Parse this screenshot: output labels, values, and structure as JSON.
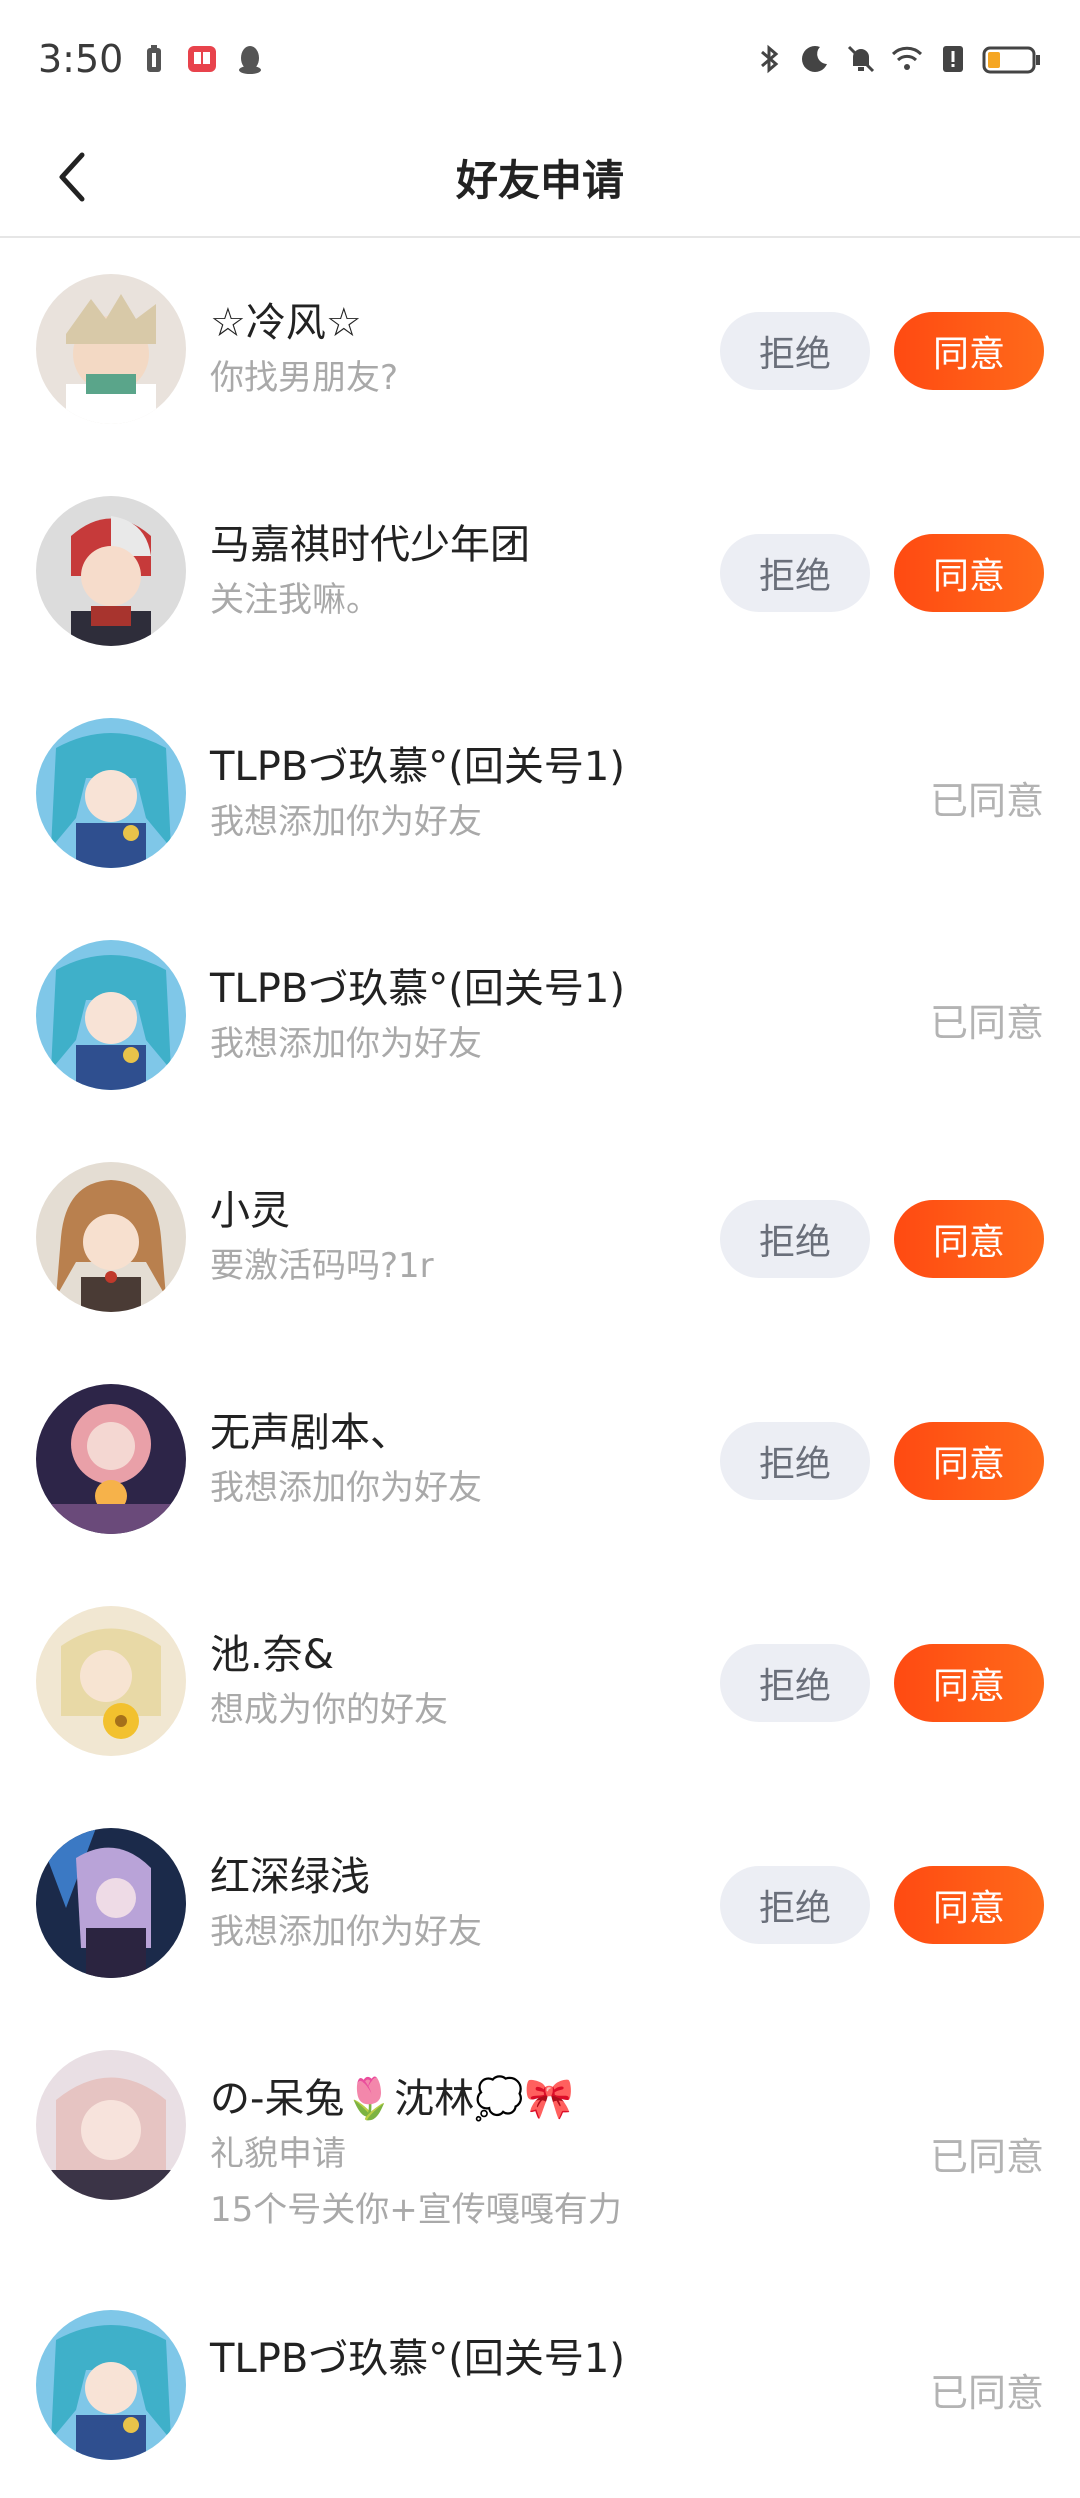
{
  "status_bar": {
    "time": "3:50",
    "left_icons": [
      "battery-saver-icon",
      "book-app-icon",
      "qq-penguin-icon"
    ],
    "right_icons": [
      "bluetooth-icon",
      "moon-icon",
      "mute-bell-icon",
      "wifi-icon",
      "sim-alert-icon",
      "battery-low-icon"
    ]
  },
  "header": {
    "title": "好友申请"
  },
  "colors": {
    "accent": "#ff5a14",
    "reject_bg": "#eceef4",
    "muted_text": "#a9a9a9"
  },
  "labels": {
    "reject": "拒绝",
    "accept": "同意",
    "accepted": "已同意"
  },
  "requests": [
    {
      "name": "☆冷风☆",
      "message": "你找男朋友?",
      "status": "pending"
    },
    {
      "name": "马嘉祺时代少年团",
      "message": "关注我嘛。",
      "status": "pending"
    },
    {
      "name": "TLPBづ玖慕°(回关号1)",
      "message": "我想添加你为好友",
      "status": "accepted"
    },
    {
      "name": "TLPBづ玖慕°(回关号1)",
      "message": "我想添加你为好友",
      "status": "accepted"
    },
    {
      "name": "小灵",
      "message": "要激活码吗?1r",
      "status": "pending"
    },
    {
      "name": "无声剧本、",
      "message": "我想添加你为好友",
      "status": "pending"
    },
    {
      "name": "池.奈&",
      "message": "想成为你的好友",
      "status": "pending"
    },
    {
      "name": "红深绿浅",
      "message": "我想添加你为好友",
      "status": "pending"
    },
    {
      "name": "の-呆兔🌷沈林💭🎀",
      "message": "礼貌申请",
      "message2": "15个号关你+宣传嘎嘎有力",
      "status": "accepted"
    },
    {
      "name": "TLPBづ玖慕°(回关号1)",
      "message": "",
      "status": "accepted"
    }
  ]
}
